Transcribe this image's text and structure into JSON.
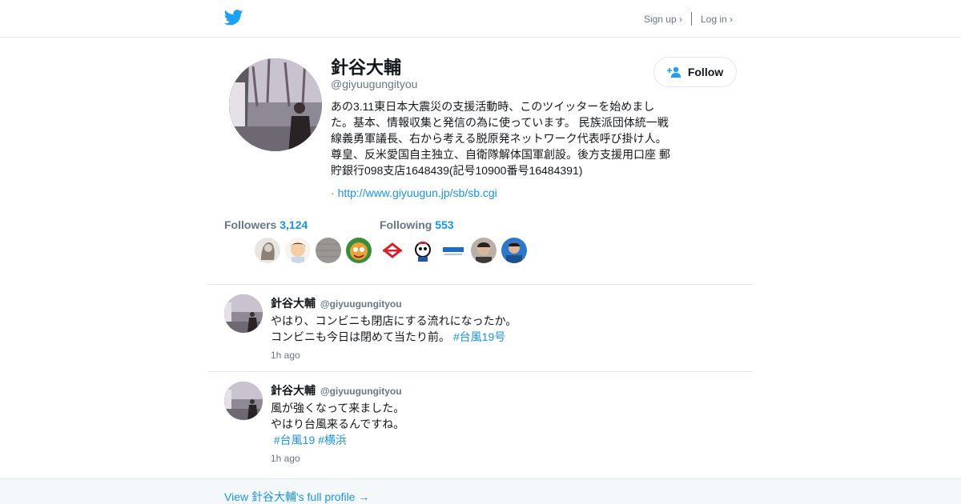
{
  "header": {
    "signup_label": "Sign up ›",
    "login_label": "Log in ›"
  },
  "profile": {
    "name": "針谷大輔",
    "handle": "@giyuugungityou",
    "bio": "あの3.11東日本大震災の支援活動時、このツイッターを始めました。基本、情報収集と発信の為に使っています。 民族派団体統一戦線義勇軍議長、右から考える脱原発ネットワーク代表呼び掛け人。尊皇、反米愛国自主独立、自衛隊解体国軍創設。後方支援用口座 郵貯銀行098支店1648439(記号10900番号16484391)",
    "url_prefix": "·",
    "url": "http://www.giyuugun.jp/sb/sb.cgi",
    "follow_label": "Follow"
  },
  "stats": {
    "followers_label": "Followers",
    "followers_count": "3,124",
    "following_label": "Following",
    "following_count": "553"
  },
  "tweets": [
    {
      "name": "針谷大輔",
      "handle": "@giyuugungityou",
      "line1": "やはり、コンビニも閉店にする流れになったか。",
      "line2": "コンビニも今日は閉めて当たり前。",
      "hashtags": [
        "#台風19号"
      ],
      "time": "1h ago"
    },
    {
      "name": "針谷大輔",
      "handle": "@giyuugungityou",
      "line1": "風が強くなって来ました。",
      "line2": "やはり台風来るんですね。",
      "hashtags": [
        "#台風19",
        "#横浜"
      ],
      "time": "1h ago"
    }
  ],
  "footer": {
    "link": "View 針谷大輔's full profile →"
  },
  "colors": {
    "brand": "#1da1f2",
    "link": "#1b95e0",
    "muted": "#657786"
  }
}
